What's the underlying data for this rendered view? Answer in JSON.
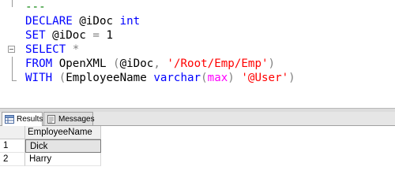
{
  "editor": {
    "lines": [
      {
        "tokens": [
          {
            "t": "---",
            "c": "cmt"
          }
        ]
      },
      {
        "tokens": [
          {
            "t": "DECLARE",
            "c": "kw"
          },
          {
            "t": " @iDoc ",
            "c": ""
          },
          {
            "t": "int",
            "c": "kw"
          }
        ]
      },
      {
        "tokens": [
          {
            "t": "SET",
            "c": "kw"
          },
          {
            "t": " @iDoc ",
            "c": ""
          },
          {
            "t": "=",
            "c": "op"
          },
          {
            "t": " 1",
            "c": ""
          }
        ]
      },
      {
        "tokens": [
          {
            "t": "SELECT",
            "c": "kw"
          },
          {
            "t": " ",
            "c": ""
          },
          {
            "t": "*",
            "c": "op"
          }
        ]
      },
      {
        "tokens": [
          {
            "t": "FROM",
            "c": "kw"
          },
          {
            "t": " OpenXML ",
            "c": ""
          },
          {
            "t": "(",
            "c": "op"
          },
          {
            "t": "@iDoc",
            "c": ""
          },
          {
            "t": ",",
            "c": "op"
          },
          {
            "t": " ",
            "c": ""
          },
          {
            "t": "'/Root/Emp/Emp'",
            "c": "str"
          },
          {
            "t": ")",
            "c": "op"
          }
        ]
      },
      {
        "tokens": [
          {
            "t": "WITH",
            "c": "kw"
          },
          {
            "t": " ",
            "c": ""
          },
          {
            "t": "(",
            "c": "op"
          },
          {
            "t": "EmployeeName ",
            "c": ""
          },
          {
            "t": "varchar",
            "c": "kw"
          },
          {
            "t": "(",
            "c": "op"
          },
          {
            "t": "max",
            "c": "fn"
          },
          {
            "t": ")",
            "c": "op"
          },
          {
            "t": " ",
            "c": ""
          },
          {
            "t": "'@User'",
            "c": "str"
          },
          {
            "t": ")",
            "c": "op"
          }
        ]
      }
    ]
  },
  "results_panel": {
    "tabs": [
      {
        "label": "Results",
        "icon": "grid-icon",
        "active": true
      },
      {
        "label": "Messages",
        "icon": "messages-icon",
        "active": false
      }
    ],
    "grid": {
      "columns": [
        "EmployeeName"
      ],
      "rows": [
        {
          "num": "1",
          "values": [
            "Dick"
          ],
          "selected": true
        },
        {
          "num": "2",
          "values": [
            "Harry"
          ],
          "selected": false
        }
      ]
    }
  },
  "colors": {
    "keyword": "#0000ff",
    "string": "#ff0000",
    "operator": "#808080",
    "function": "#ff00ff",
    "comment": "#008000"
  }
}
